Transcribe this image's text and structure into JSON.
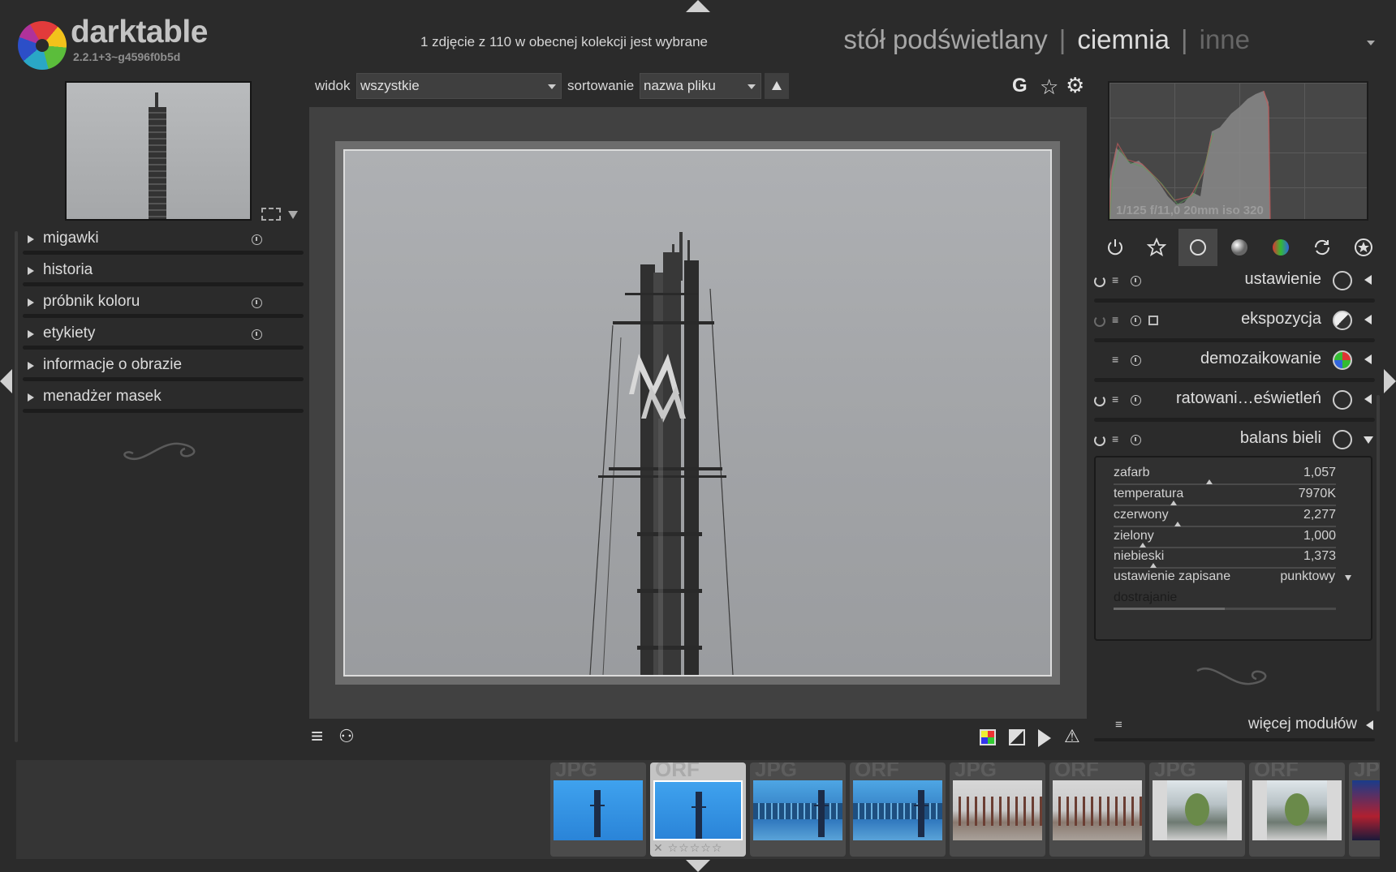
{
  "app": {
    "name": "darktable",
    "version": "2.2.1+3~g4596f0b5d"
  },
  "header": {
    "selection_info": "1 zdjęcie z 110 w obecnej kolekcji jest wybrane",
    "views": [
      {
        "label": "stół podświetlany",
        "active": false
      },
      {
        "label": "ciemnia",
        "active": true
      },
      {
        "label": "inne",
        "active": false
      }
    ],
    "separator": "|"
  },
  "left_panel": {
    "modules": [
      {
        "label": "migawki",
        "has_reset": true
      },
      {
        "label": "historia",
        "has_reset": false
      },
      {
        "label": "próbnik koloru",
        "has_reset": true
      },
      {
        "label": "etykiety",
        "has_reset": true
      },
      {
        "label": "informacje o obrazie",
        "has_reset": false
      },
      {
        "label": "menadżer masek",
        "has_reset": false
      }
    ]
  },
  "top_toolbar": {
    "view_label": "widok",
    "view_value": "wszystkie",
    "sort_label": "sortowanie",
    "sort_value": "nazwa pliku",
    "icons": [
      "guides-g-icon",
      "star-icon",
      "gear-icon"
    ],
    "g_glyph": "G",
    "star_glyph": "☆",
    "gear_glyph": "⚙"
  },
  "bottom_toolbar": {
    "menu_glyph": "≡",
    "styles_glyph": "⚇",
    "warning_glyph": "⚠"
  },
  "histogram": {
    "exif": "1/125 f/11,0 20mm iso 320"
  },
  "module_groups": [
    {
      "name": "power-icon",
      "active": false
    },
    {
      "name": "favorites-star-icon",
      "active": false
    },
    {
      "name": "basic-circle-icon",
      "active": true
    },
    {
      "name": "tone-sphere-icon",
      "active": false
    },
    {
      "name": "color-sphere-icon",
      "active": false
    },
    {
      "name": "correct-arrows-icon",
      "active": false
    },
    {
      "name": "effect-icon",
      "active": false
    }
  ],
  "right_modules": [
    {
      "name": "ustawienie",
      "power": true,
      "power_dim": false,
      "menu": "≡",
      "duplicate": false,
      "expanded": false
    },
    {
      "name": "ekspozycja",
      "power": true,
      "power_dim": true,
      "menu": "≡",
      "duplicate": true,
      "expanded": false
    },
    {
      "name": "demozaikowanie",
      "power": false,
      "power_dim": false,
      "menu": "≡",
      "duplicate": false,
      "expanded": false
    },
    {
      "name": "ratowani…eświetleń",
      "power": true,
      "power_dim": false,
      "menu": "≡",
      "duplicate": false,
      "expanded": false
    },
    {
      "name": "balans bieli",
      "power": true,
      "power_dim": false,
      "menu": "≡",
      "duplicate": false,
      "expanded": true
    }
  ],
  "white_balance": {
    "sliders": [
      {
        "label": "zafarb",
        "value": "1,057",
        "position": 0.43
      },
      {
        "label": "temperatura",
        "value": "7970K",
        "position": 0.27
      },
      {
        "label": "czerwony",
        "value": "2,277",
        "position": 0.29
      },
      {
        "label": "zielony",
        "value": "1,000",
        "position": 0.13
      },
      {
        "label": "niebieski",
        "value": "1,373",
        "position": 0.18
      }
    ],
    "preset_label": "ustawienie zapisane",
    "preset_value": "punktowy",
    "finetune_label": "dostrajanie",
    "finetune_position": 0.5
  },
  "more_modules": {
    "menu": "≡",
    "label": "więcej modułów"
  },
  "filmstrip": {
    "thumbnails": [
      {
        "ext": "JPG",
        "style": "blue",
        "selected": false
      },
      {
        "ext": "ORF",
        "style": "blue",
        "selected": true,
        "stars": "✕ ☆☆☆☆☆"
      },
      {
        "ext": "JPG",
        "style": "blue2",
        "selected": false
      },
      {
        "ext": "ORF",
        "style": "blue2",
        "selected": false
      },
      {
        "ext": "JPG",
        "style": "street",
        "selected": false
      },
      {
        "ext": "ORF",
        "style": "street",
        "selected": false
      },
      {
        "ext": "JPG",
        "style": "court",
        "selected": false
      },
      {
        "ext": "ORF",
        "style": "court",
        "selected": false
      },
      {
        "ext": "JP",
        "style": "dark",
        "selected": false
      }
    ]
  }
}
